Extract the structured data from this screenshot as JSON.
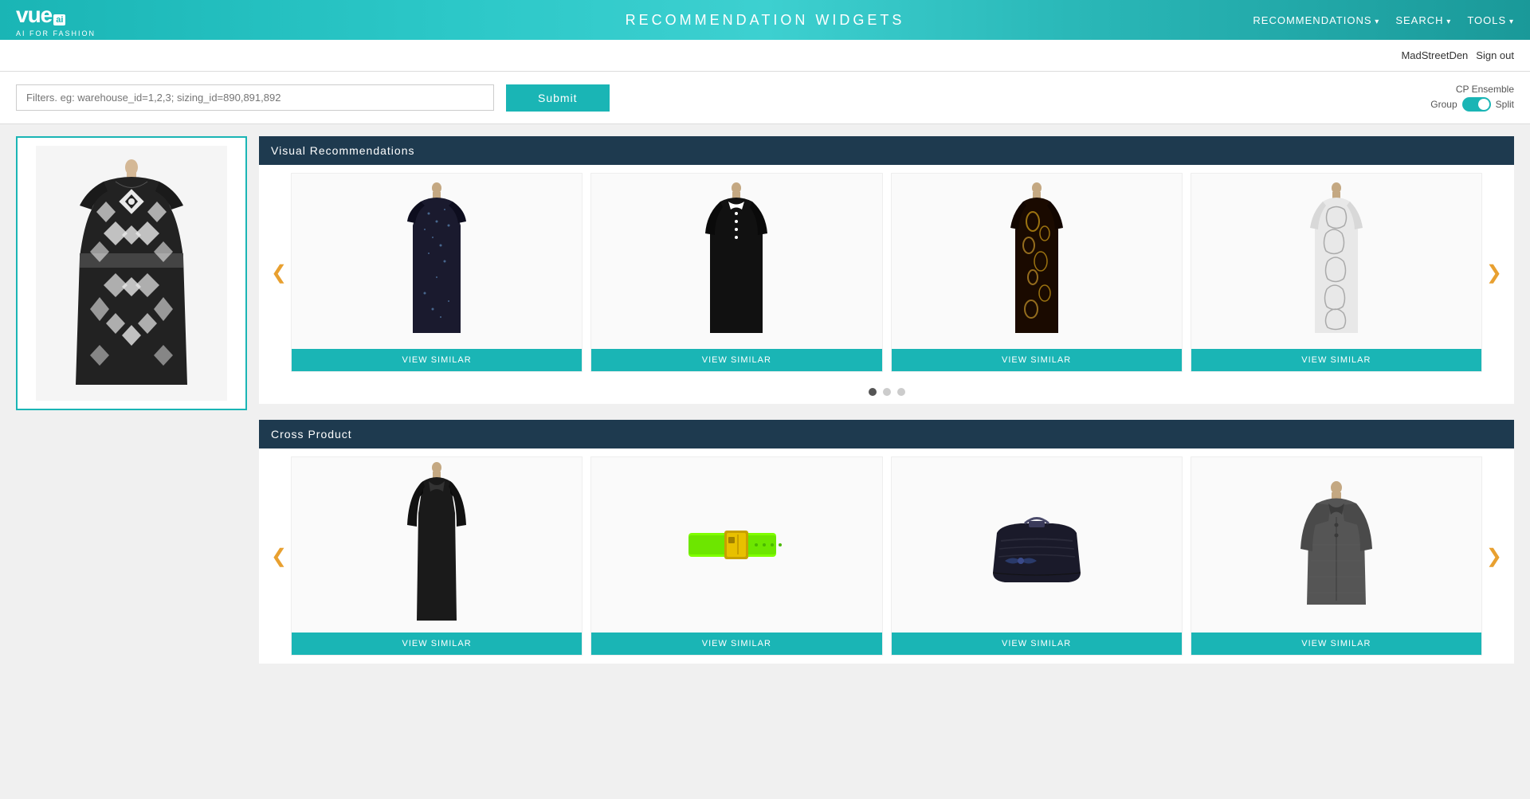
{
  "header": {
    "logo": "vue",
    "logo_ai": "ai",
    "logo_sub": "AI FOR FASHION",
    "title": "RECOMMENDATION   WIDGETS",
    "nav_items": [
      "RECOMMENDATIONS",
      "SEARCH",
      "TOOLS"
    ]
  },
  "sub_header": {
    "username": "MadStreetDen",
    "signout": "Sign out"
  },
  "search": {
    "placeholder": "Filters. eg: warehouse_id=1,2,3; sizing_id=890,891,892",
    "submit_label": "Submit"
  },
  "toggle": {
    "cp_ensemble_label": "CP Ensemble",
    "group_label": "Group",
    "split_label": "Split"
  },
  "visual_recommendations": {
    "title": "Visual Recommendations",
    "view_similar_label": "VIEW SIMILAR",
    "prev_btn": "❮",
    "next_btn": "❯",
    "pagination": [
      1,
      2,
      3
    ],
    "active_dot": 0
  },
  "cross_product": {
    "title": "Cross Product",
    "view_similar_label": "VIEW SIMILAR",
    "prev_btn": "❮",
    "next_btn": "❯"
  }
}
